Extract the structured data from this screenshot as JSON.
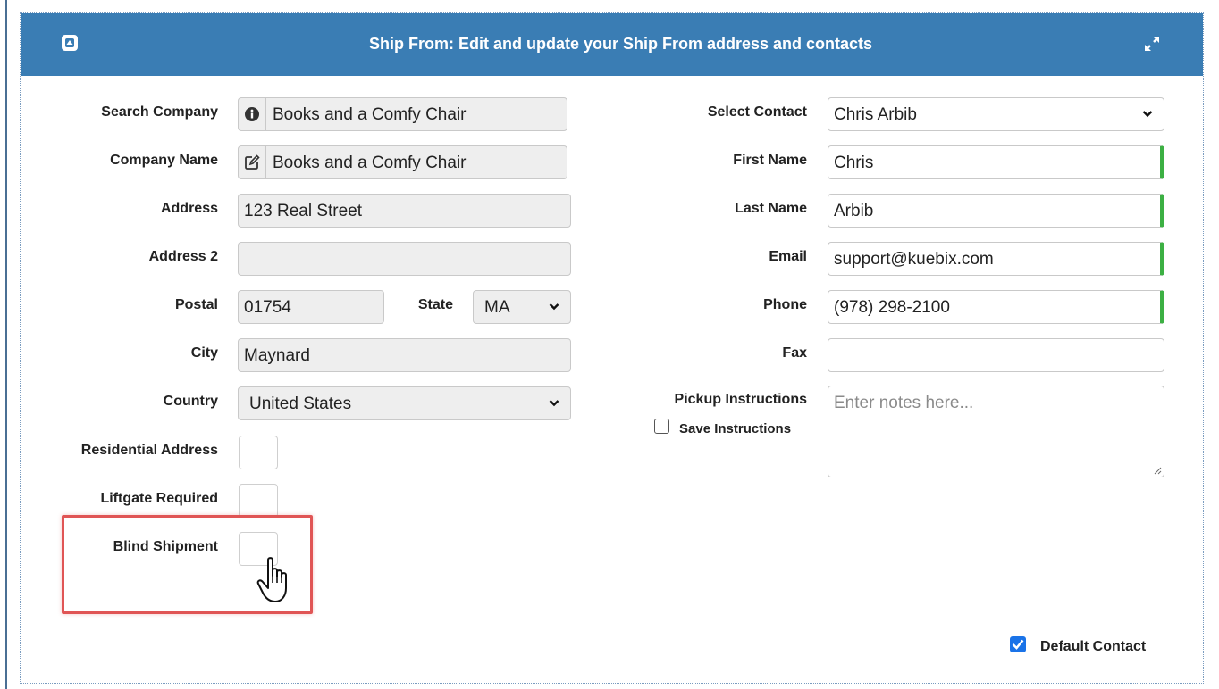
{
  "panel": {
    "title": "Ship From: Edit and update your Ship From address and contacts",
    "collapse_icon": "collapse-up-icon",
    "expand_icon": "expand-arrows-icon",
    "header_color": "#3a7db4"
  },
  "left": {
    "search_company": {
      "label": "Search Company",
      "value": "Books and a Comfy Chair",
      "icon": "info-circle-icon"
    },
    "company_name": {
      "label": "Company Name",
      "value": "Books and a Comfy Chair",
      "icon": "edit-icon"
    },
    "address": {
      "label": "Address",
      "value": "123 Real Street"
    },
    "address2": {
      "label": "Address 2",
      "value": ""
    },
    "postal": {
      "label": "Postal",
      "value": "01754"
    },
    "state": {
      "label": "State",
      "value": "MA"
    },
    "city": {
      "label": "City",
      "value": "Maynard"
    },
    "country": {
      "label": "Country",
      "value": "United States"
    },
    "residential": {
      "label": "Residential Address",
      "checked": false
    },
    "liftgate": {
      "label": "Liftgate Required",
      "checked": false
    },
    "blind_shipment": {
      "label": "Blind Shipment",
      "checked": false
    }
  },
  "right": {
    "select_contact": {
      "label": "Select Contact",
      "value": "Chris Arbib"
    },
    "first_name": {
      "label": "First Name",
      "value": "Chris"
    },
    "last_name": {
      "label": "Last Name",
      "value": "Arbib"
    },
    "email": {
      "label": "Email",
      "value": "support@kuebix.com"
    },
    "phone": {
      "label": "Phone",
      "value": "(978) 298-2100"
    },
    "fax": {
      "label": "Fax",
      "value": ""
    },
    "pickup": {
      "label": "Pickup Instructions",
      "placeholder": "Enter notes here..."
    },
    "save_instructions": {
      "label": "Save Instructions",
      "checked": false
    },
    "default_contact": {
      "label": "Default Contact",
      "checked": true
    }
  },
  "colors": {
    "valid_accent": "#3cb043",
    "highlight": "#e05555",
    "checkbox_checked": "#1a73e8"
  }
}
